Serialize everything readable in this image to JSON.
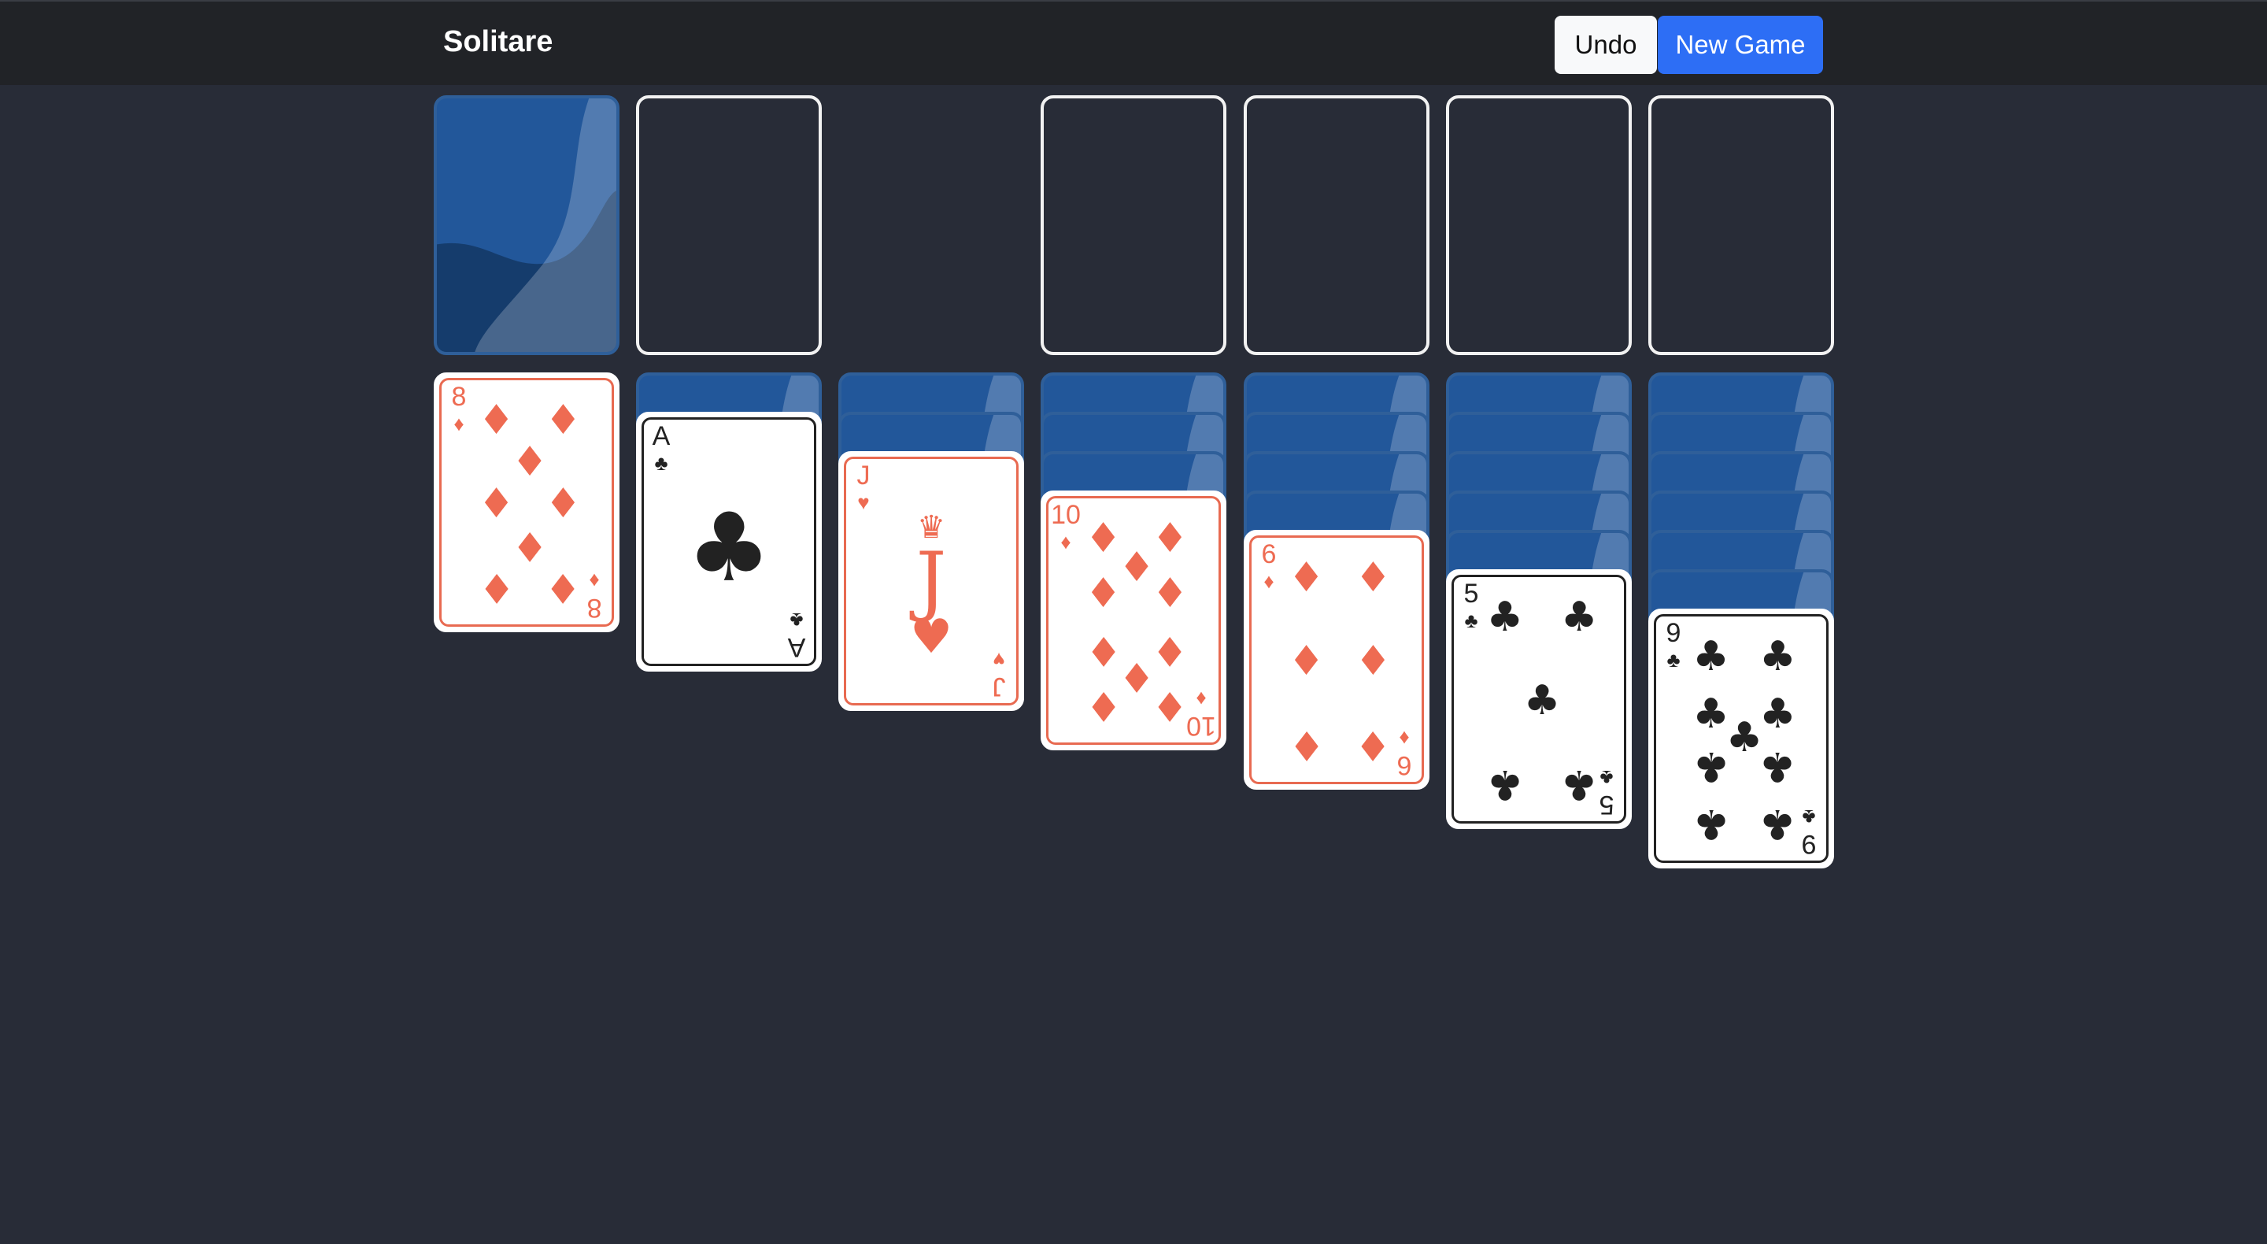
{
  "header": {
    "title": "Solitare",
    "undo_label": "Undo",
    "new_game_label": "New Game"
  },
  "colors": {
    "background": "#282c37",
    "topbar": "#212327",
    "card_back": "#22579a",
    "red_suit": "#ee6b52",
    "black_suit": "#222222",
    "primary_button": "#2d6ef5"
  },
  "stock": {
    "face_down_cards": 1
  },
  "waste": {
    "cards": []
  },
  "foundations": [
    {
      "cards": []
    },
    {
      "cards": []
    },
    {
      "cards": []
    },
    {
      "cards": []
    }
  ],
  "tableau": [
    {
      "face_down": 0,
      "top": {
        "rank": "8",
        "suit": "♦",
        "color": "red",
        "pips": 8
      }
    },
    {
      "face_down": 1,
      "top": {
        "rank": "A",
        "suit": "♣",
        "color": "black",
        "pips": 1
      }
    },
    {
      "face_down": 2,
      "top": {
        "rank": "J",
        "suit": "♥",
        "color": "red",
        "pips": 0
      }
    },
    {
      "face_down": 3,
      "top": {
        "rank": "10",
        "suit": "♦",
        "color": "red",
        "pips": 10
      }
    },
    {
      "face_down": 4,
      "top": {
        "rank": "6",
        "suit": "♦",
        "color": "red",
        "pips": 6
      }
    },
    {
      "face_down": 5,
      "top": {
        "rank": "5",
        "suit": "♣",
        "color": "black",
        "pips": 5
      }
    },
    {
      "face_down": 6,
      "top": {
        "rank": "9",
        "suit": "♣",
        "color": "black",
        "pips": 9
      }
    }
  ]
}
